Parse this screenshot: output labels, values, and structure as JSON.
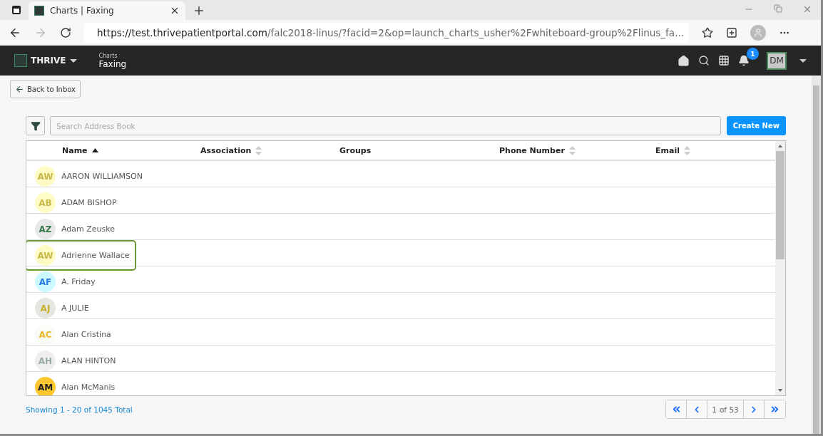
{
  "browser": {
    "tab_title": "Charts | Faxing",
    "url_host": "https://test.thrivepatientportal.com",
    "url_path": "/falc2018-linus/?facid=2&op=launch_charts_usher%2Fwhiteboard-group%2Flinus_fa..."
  },
  "app": {
    "brand": "THRIVE",
    "section": "Charts",
    "page": "Faxing",
    "notification_count": "1",
    "user_initials": "DM"
  },
  "back_button": "Back to Inbox",
  "search": {
    "placeholder": "Search Address Book"
  },
  "create_button": "Create New",
  "columns": [
    {
      "label": "Name",
      "sortable": true,
      "sorted_ascending": true
    },
    {
      "label": "Association",
      "sortable": true,
      "sorted_ascending": false
    },
    {
      "label": "Groups",
      "sortable": false,
      "sorted_ascending": false
    },
    {
      "label": "Phone Number",
      "sortable": true,
      "sorted_ascending": false
    },
    {
      "label": "Email",
      "sortable": true,
      "sorted_ascending": false
    }
  ],
  "rows": [
    {
      "initials": "AW",
      "name": "AARON WILLIAMSON",
      "color": "#fffbc4",
      "highlighted": false
    },
    {
      "initials": "AB",
      "name": "ADAM BISHOP",
      "color": "#fffbc4",
      "highlighted": false
    },
    {
      "initials": "AZ",
      "name": "Adam Zeuske",
      "color": "#e8e8e8",
      "highlighted": false
    },
    {
      "initials": "AW",
      "name": "Adrienne Wallace",
      "color": "#fffbc4",
      "highlighted": true
    },
    {
      "initials": "AF",
      "name": "A. Friday",
      "color": "#ccf9ff",
      "highlighted": false
    },
    {
      "initials": "AJ",
      "name": "A JULIE",
      "color": "#e6e6e0",
      "highlighted": false
    },
    {
      "initials": "AC",
      "name": "Alan Cristina",
      "color": "#fbfbf5",
      "highlighted": false
    },
    {
      "initials": "AH",
      "name": "ALAN HINTON",
      "color": "#eeeeee",
      "highlighted": false
    },
    {
      "initials": "AM",
      "name": "Alan McManis",
      "color": "#fdc82f",
      "highlighted": false
    }
  ],
  "footer": {
    "summary": "Showing 1 - 20 of 1045 Total",
    "page": "1",
    "page_total": "of 53"
  }
}
